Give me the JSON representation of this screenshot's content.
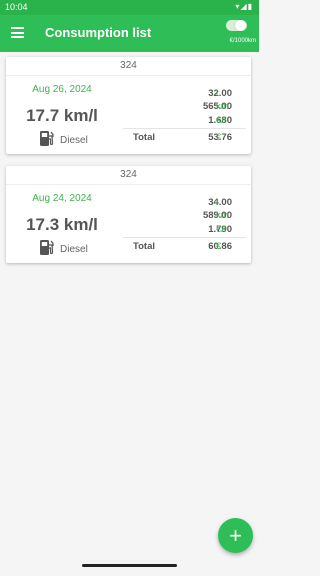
{
  "status_bar": {
    "time": "10:04",
    "icons": "▾◢▮"
  },
  "app_bar": {
    "title": "Consumption list",
    "unit_toggle_label": "€/1000km"
  },
  "entries": [
    {
      "header": "324",
      "date": "Aug 26, 2024",
      "consumption": "17.7 km/l",
      "fuel_type": "Diesel",
      "volume": "32.00",
      "volume_unit": "l",
      "distance": "565.00",
      "distance_unit": "km",
      "price": "1.680",
      "price_unit": "€/l",
      "total_label": "Total",
      "total": "53.76",
      "total_unit": "€"
    },
    {
      "header": "324",
      "date": "Aug 24, 2024",
      "consumption": "17.3 km/l",
      "fuel_type": "Diesel",
      "volume": "34.00",
      "volume_unit": "l",
      "distance": "589.00",
      "distance_unit": "km",
      "price": "1.790",
      "price_unit": "€/l",
      "total_label": "Total",
      "total": "60.86",
      "total_unit": "€"
    }
  ],
  "fab": {
    "icon": "+"
  },
  "colors": {
    "primary": "#2ebd57",
    "status_bar": "#2ab34a",
    "accent_text": "#3fb34f"
  }
}
